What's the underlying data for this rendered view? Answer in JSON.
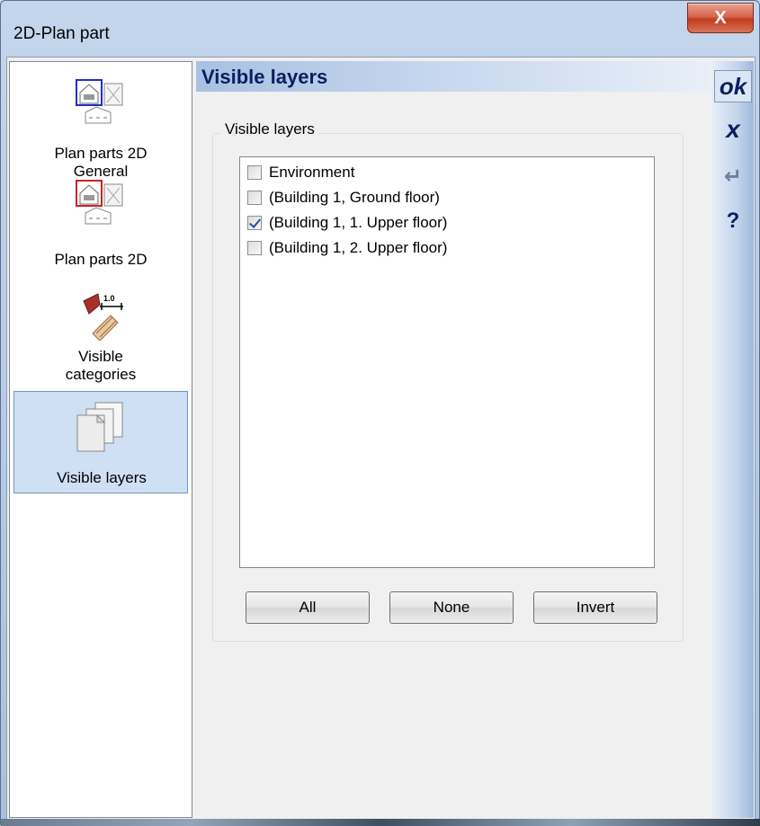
{
  "window": {
    "title": "2D-Plan part",
    "close_label": "X"
  },
  "nav": {
    "items": [
      {
        "label_lines": [
          "Plan parts 2D",
          "General"
        ],
        "icon": "plan-parts-general-icon"
      },
      {
        "label_lines": [
          "Plan parts 2D"
        ],
        "icon": "plan-parts-icon"
      },
      {
        "label_lines": [
          "Visible",
          "categories"
        ],
        "icon": "visible-categories-icon"
      },
      {
        "label_lines": [
          "Visible layers"
        ],
        "icon": "visible-layers-icon",
        "selected": true
      }
    ]
  },
  "panel": {
    "title": "Visible layers",
    "group_label": "Visible layers",
    "layers": [
      {
        "label": "Environment",
        "checked": false
      },
      {
        "label": "(Building 1, Ground floor)",
        "checked": false
      },
      {
        "label": "(Building 1, 1. Upper floor)",
        "checked": true
      },
      {
        "label": "(Building 1, 2. Upper floor)",
        "checked": false
      }
    ],
    "buttons": {
      "all": "All",
      "none": "None",
      "invert": "Invert"
    }
  },
  "toolbar": {
    "ok": "ok",
    "cancel": "x",
    "enter": "↵",
    "help": "?"
  },
  "colors": {
    "accent": "#0b1f5e",
    "selection": "#cfdff4",
    "close_button": "#c23a1e"
  }
}
